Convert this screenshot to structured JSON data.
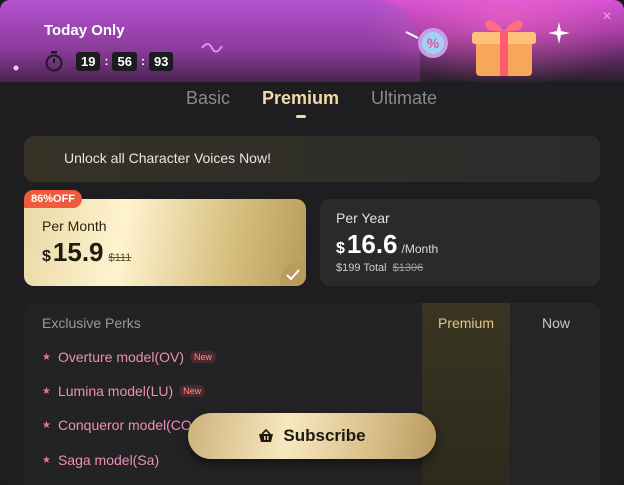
{
  "header": {
    "title": "Today Only",
    "timer": {
      "hours": "19",
      "minutes": "56",
      "seconds": "93",
      "separator": ":"
    },
    "close_icon": "×"
  },
  "tabs": [
    {
      "label": "Basic",
      "active": false
    },
    {
      "label": "Premium",
      "active": true
    },
    {
      "label": "Ultimate",
      "active": false
    }
  ],
  "unlock_banner": {
    "text": "Unlock all Character Voices Now!"
  },
  "plans": {
    "month": {
      "badge": "86%OFF",
      "label": "Per Month",
      "currency": "$",
      "price": "15.9",
      "original": "$111",
      "selected": true
    },
    "year": {
      "label": "Per Year",
      "currency": "$",
      "price": "16.6",
      "per": "/Month",
      "total_prefix": "$199 Total",
      "total_original": "$1306",
      "selected": false
    }
  },
  "perks": {
    "heading": "Exclusive Perks",
    "col_premium": "Premium",
    "col_now": "Now",
    "items": [
      {
        "label": "Overture model(OV)",
        "badge": "New"
      },
      {
        "label": "Lumina model(LU)",
        "badge": "New"
      },
      {
        "label": "Conqueror model(CO",
        "badge": ""
      },
      {
        "label": "Saga model(Sa)",
        "badge": ""
      }
    ]
  },
  "subscribe_button": {
    "label": "Subscribe"
  },
  "colors": {
    "accent_gold": "#f3d9a8",
    "badge_red": "#ef5b3c",
    "perk_pink": "#ee8fb4",
    "banner_magenta": "#d34fd6"
  }
}
